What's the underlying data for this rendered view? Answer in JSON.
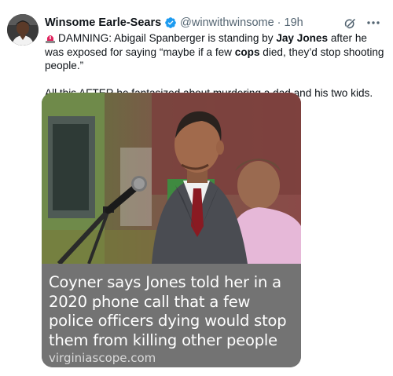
{
  "tweet": {
    "author_name": "Winsome Earle-Sears",
    "handle": "@winwithwinsome",
    "separator": "·",
    "time": "19h",
    "line1_prefix": "DAMNING: Abigail Spanberger is standing by ",
    "line1_bold1": "Jay Jones",
    "line1_mid": " after he was exposed for saying “maybe if a few ",
    "line1_bold2": "cops",
    "line1_suffix": " died, they’d stop shooting people.”",
    "line2": "All this AFTER he fantasized about murdering a dad and his two kids."
  },
  "card": {
    "title": "Coyner says Jones told her in a 2020 phone call that a few police officers dying would stop them from killing other people",
    "domain": "virginiascope.com"
  },
  "icons": {
    "verified": "verified-badge-icon",
    "grok": "grok-icon",
    "more": "more-options-icon",
    "siren": "rotating-light-emoji-icon"
  },
  "colors": {
    "verified": "#1d9bf0",
    "secondary_text": "#536471",
    "caption_bg": "#737373"
  }
}
